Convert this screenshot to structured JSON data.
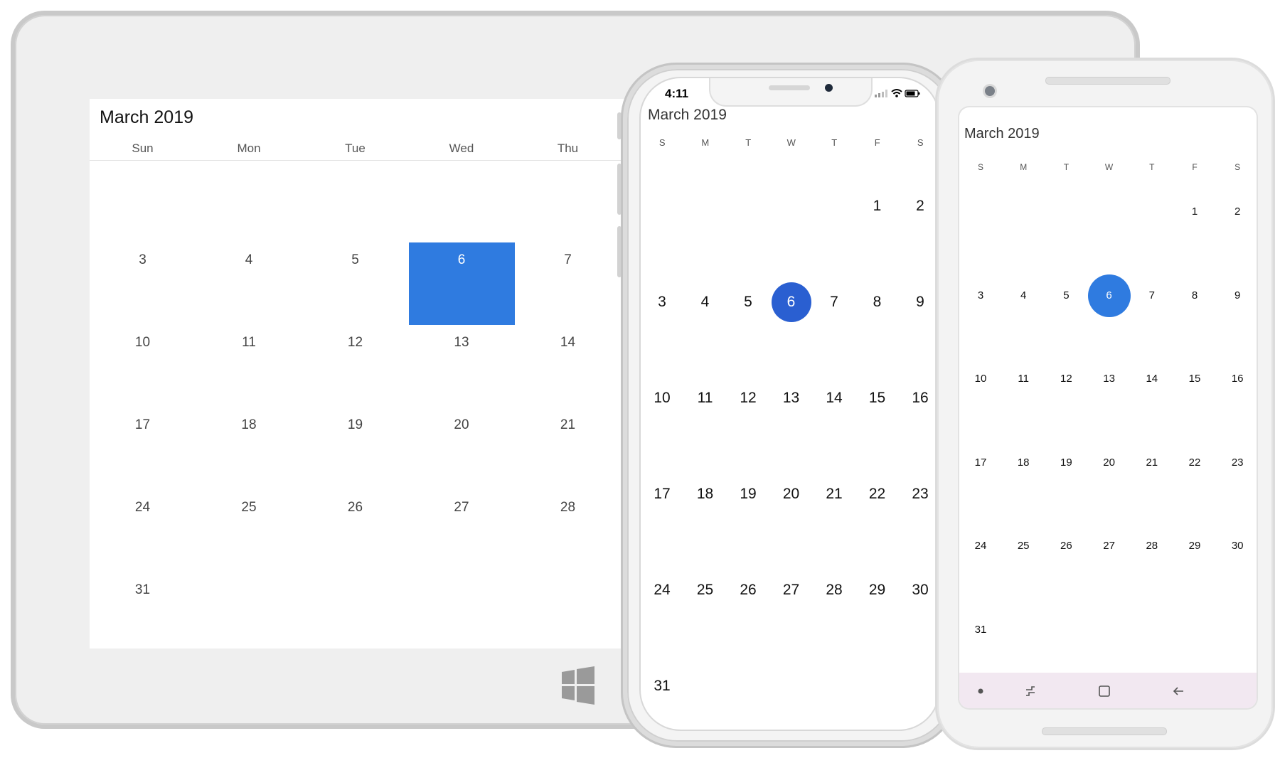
{
  "tablet": {
    "title": "March 2019",
    "day_headers": [
      "Sun",
      "Mon",
      "Tue",
      "Wed",
      "Thu"
    ],
    "weeks": [
      [
        "",
        "",
        "",
        "",
        ""
      ],
      [
        "3",
        "4",
        "5",
        "6",
        "7"
      ],
      [
        "10",
        "11",
        "12",
        "13",
        "14"
      ],
      [
        "17",
        "18",
        "19",
        "20",
        "21"
      ],
      [
        "24",
        "25",
        "26",
        "27",
        "28"
      ],
      [
        "31",
        "",
        "",
        "",
        ""
      ]
    ],
    "selected_date": "6",
    "logo_icon": "windows-logo-icon"
  },
  "iphone": {
    "time": "4:11",
    "status_icons": [
      "signal-icon",
      "wifi-icon",
      "battery-icon"
    ],
    "title": "March 2019",
    "day_headers": [
      "S",
      "M",
      "T",
      "W",
      "T",
      "F",
      "S"
    ],
    "weeks": [
      [
        "",
        "",
        "",
        "",
        "",
        "1",
        "2"
      ],
      [
        "3",
        "4",
        "5",
        "6",
        "7",
        "8",
        "9"
      ],
      [
        "10",
        "11",
        "12",
        "13",
        "14",
        "15",
        "16"
      ],
      [
        "17",
        "18",
        "19",
        "20",
        "21",
        "22",
        "23"
      ],
      [
        "24",
        "25",
        "26",
        "27",
        "28",
        "29",
        "30"
      ],
      [
        "31",
        "",
        "",
        "",
        "",
        "",
        ""
      ]
    ],
    "selected_date": "6"
  },
  "android": {
    "title": "March 2019",
    "day_headers": [
      "S",
      "M",
      "T",
      "W",
      "T",
      "F",
      "S"
    ],
    "weeks": [
      [
        "",
        "",
        "",
        "",
        "",
        "1",
        "2"
      ],
      [
        "3",
        "4",
        "5",
        "6",
        "7",
        "8",
        "9"
      ],
      [
        "10",
        "11",
        "12",
        "13",
        "14",
        "15",
        "16"
      ],
      [
        "17",
        "18",
        "19",
        "20",
        "21",
        "22",
        "23"
      ],
      [
        "24",
        "25",
        "26",
        "27",
        "28",
        "29",
        "30"
      ],
      [
        "31",
        "",
        "",
        "",
        "",
        "",
        ""
      ]
    ],
    "selected_date": "6",
    "nav_icons": [
      "dot-icon",
      "recent-apps-icon",
      "overview-icon",
      "back-arrow-icon"
    ]
  },
  "colors": {
    "selected_blue_windows": "#2f7be0",
    "selected_blue_ios": "#2a5fd1",
    "selected_blue_android": "#2f7be0",
    "android_navbar": "#f2e8f1"
  }
}
